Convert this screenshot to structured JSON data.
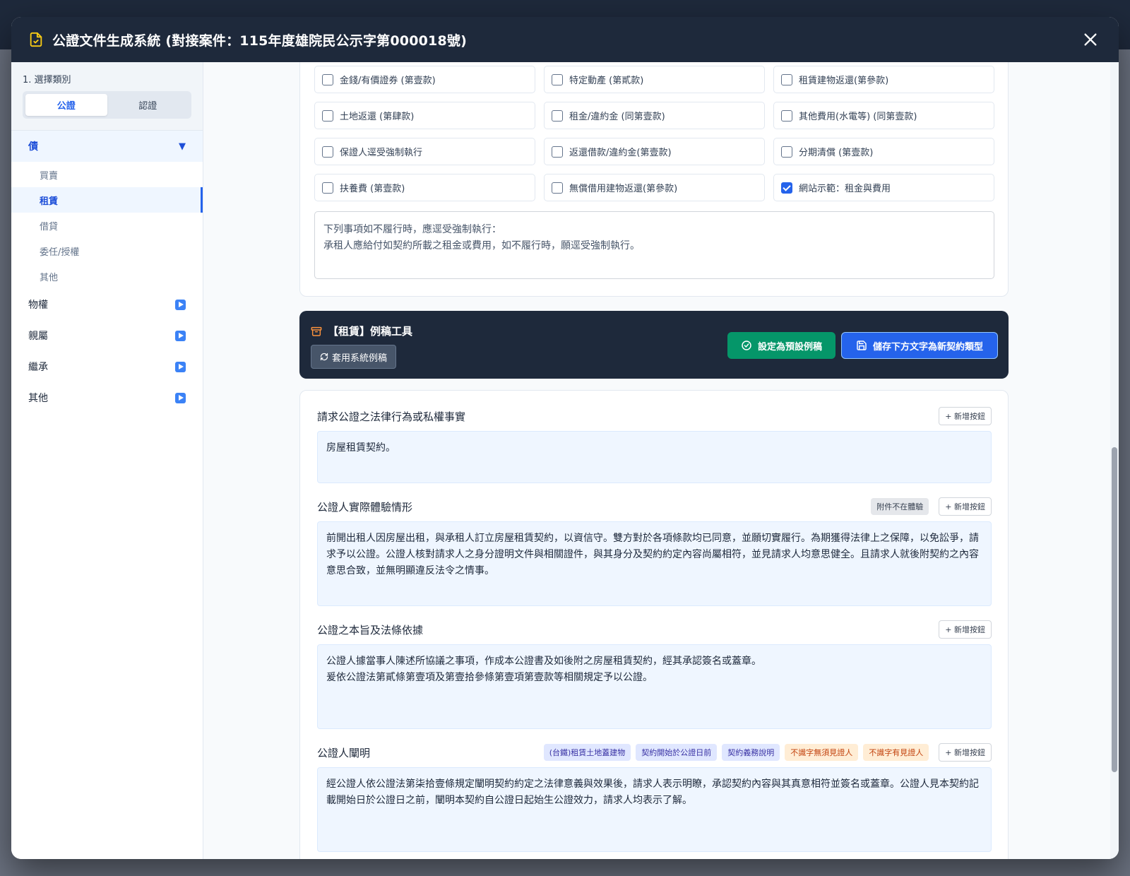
{
  "modal": {
    "title": "公證文件生成系統 (對接案件：115年度雄院民公示字第000018號)"
  },
  "sidebar": {
    "step_label": "1. 選擇類別",
    "seg": [
      "公證",
      "認證"
    ],
    "open_category": "債",
    "subitems": [
      "買賣",
      "租賃",
      "借貸",
      "委任/授權",
      "其他"
    ],
    "categories": [
      "物權",
      "親屬",
      "繼承",
      "其他"
    ]
  },
  "checkboxes": [
    "金錢/有價證券 (第壹款)",
    "特定動產 (第貳款)",
    "租賃建物返還(第參款)",
    "土地返還 (第肆款)",
    "租金/違約金 (同第壹款)",
    "其他費用(水電等) (同第壹款)",
    "保證人逕受強制執行",
    "返還借款/違約金(第壹款)",
    "分期清償 (第壹款)",
    "扶養費 (第壹款)",
    "無償借用建物返還(第參款)",
    "網站示範：租金與費用"
  ],
  "notice": {
    "line1": "下列事項如不履行時，應逕受強制執行：",
    "line2": "承租人應給付如契約所載之租金或費用，如不履行時，願逕受強制執行。"
  },
  "toolbar": {
    "title": "【租賃】例稿工具",
    "apply_label": "套用系統例稿",
    "set_default_label": "設定為預設例稿",
    "save_new_label": "儲存下方文字為新契約類型"
  },
  "sections": {
    "s1": {
      "label": "請求公證之法律行為或私權事實",
      "add": "+ 新增按鈕",
      "text": "房屋租賃契約。"
    },
    "s2": {
      "label": "公證人實際體驗情形",
      "tag": "附件不在體驗",
      "add": "+ 新增按鈕",
      "text": "前開出租人因房屋出租，與承租人訂立房屋租賃契約，以資信守。雙方對於各項條款均已同意，並願切實履行。為期獲得法律上之保障，以免訟爭，請求予以公證。公證人核對請求人之身分證明文件與相關證件，與其身分及契約約定內容尚屬相符，並見請求人均意思健全。且請求人就後附契約之內容意思合致，並無明顯違反法令之情事。"
    },
    "s3": {
      "label": "公證之本旨及法條依據",
      "add": "+ 新增按鈕",
      "line1": "公證人據當事人陳述所協議之事項，作成本公證書及如後附之房屋租賃契約，經其承認簽名或蓋章。",
      "line2": "爰依公證法第貳條第壹項及第壹拾參條第壹項第壹款等相關規定予以公證。"
    },
    "s4": {
      "label": "公證人闡明",
      "tags": [
        "(台鐵)租賃土地蓋建物",
        "契約開始於公證日前",
        "契約義務說明",
        "不識字無須見證人",
        "不識字有見證人"
      ],
      "add": "+ 新增按鈕",
      "text": "經公證人依公證法第柒拾壹條規定闡明契約約定之法律意義與效果後，請求人表示明瞭，承認契約內容與其真意相符並簽名或蓋章。公證人見本契約記載開始日於公證日之前，闡明本契約自公證日起始生公證效力，請求人均表示了解。"
    }
  },
  "colors": {
    "header": "#1e293b",
    "accent": "#2563eb",
    "success": "#059669"
  }
}
